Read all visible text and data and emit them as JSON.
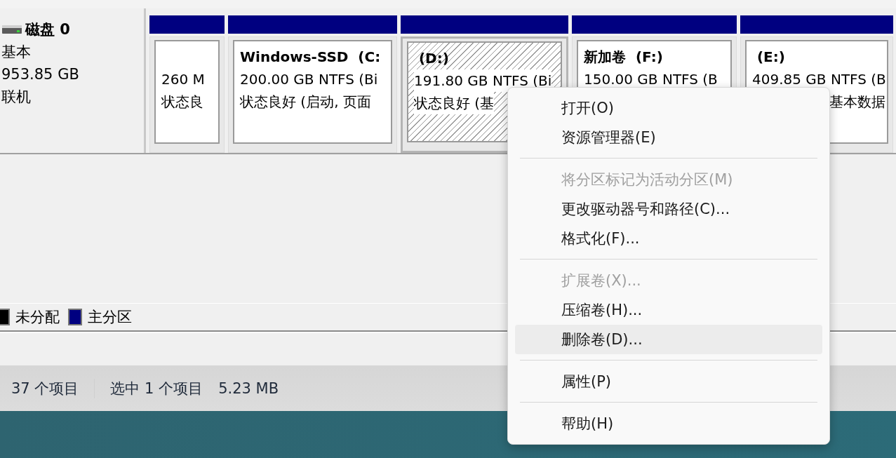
{
  "disk": {
    "name": "磁盘 0",
    "type": "基本",
    "size": "953.85 GB",
    "status": "联机"
  },
  "partitions": [
    {
      "size": "260 M",
      "status": "状态良",
      "selected": false
    },
    {
      "title": "Windows-SSD  (C:",
      "size": "200.00 GB NTFS (Bi",
      "status": "状态良好 (启动, 页面",
      "selected": false
    },
    {
      "title": " (D:)",
      "size": "191.80 GB NTFS (Bi",
      "status": "状态良好 (基",
      "selected": true
    },
    {
      "title": "新加卷  (F:)",
      "size": "150.00 GB NTFS (B",
      "selected": false
    },
    {
      "title": " (E:)",
      "size": "409.85 GB NTFS (B",
      "status": "基本数据",
      "selected": false
    }
  ],
  "legend": [
    {
      "label": "未分配",
      "color": "#000000"
    },
    {
      "label": "主分区",
      "color": "#000080"
    }
  ],
  "status_bar": [
    "37 个项目",
    "选中 1 个项目",
    "5.23 MB"
  ],
  "context_menu": [
    {
      "kind": "item",
      "label": "打开(O)",
      "disabled": false,
      "selected": false
    },
    {
      "kind": "item",
      "label": "资源管理器(E)",
      "disabled": false,
      "selected": false
    },
    {
      "kind": "separator"
    },
    {
      "kind": "item",
      "label": "将分区标记为活动分区(M)",
      "disabled": true,
      "selected": false
    },
    {
      "kind": "item",
      "label": "更改驱动器号和路径(C)...",
      "disabled": false,
      "selected": false
    },
    {
      "kind": "item",
      "label": "格式化(F)...",
      "disabled": false,
      "selected": false
    },
    {
      "kind": "separator"
    },
    {
      "kind": "item",
      "label": "扩展卷(X)...",
      "disabled": true,
      "selected": false
    },
    {
      "kind": "item",
      "label": "压缩卷(H)...",
      "disabled": false,
      "selected": false
    },
    {
      "kind": "item",
      "label": "删除卷(D)...",
      "disabled": false,
      "selected": true
    },
    {
      "kind": "separator"
    },
    {
      "kind": "item",
      "label": "属性(P)",
      "disabled": false,
      "selected": false
    },
    {
      "kind": "separator"
    },
    {
      "kind": "item",
      "label": "帮助(H)",
      "disabled": false,
      "selected": false
    }
  ]
}
